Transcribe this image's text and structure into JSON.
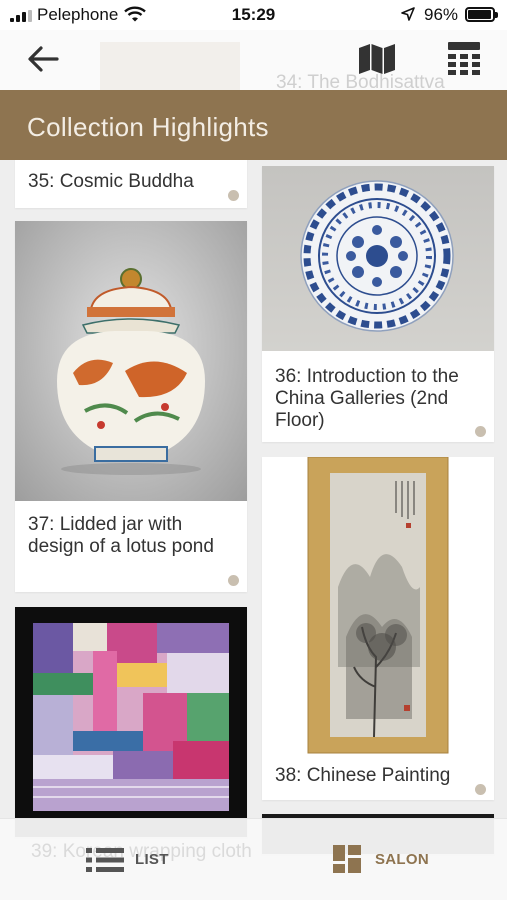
{
  "status_bar": {
    "carrier": "Pelephone",
    "time": "15:29",
    "battery": "96%"
  },
  "header": {
    "title": "Collection Highlights",
    "behind_text": "34: The Bodhisattva"
  },
  "items": [
    {
      "caption": "35: Cosmic Buddha"
    },
    {
      "caption": "36: Introduction to the China Galleries (2nd Floor)"
    },
    {
      "caption": "37: Lidded jar with design of a lotus pond"
    },
    {
      "caption": "38: Chinese Painting"
    }
  ],
  "footer": {
    "behind_text": "39: Korean wrapping cloth",
    "tabs": [
      {
        "label": "LIST"
      },
      {
        "label": "SALON"
      }
    ]
  },
  "colors": {
    "accent": "#8e7450",
    "title_text": "#f3ede4",
    "dot": "#c9bfb0"
  }
}
